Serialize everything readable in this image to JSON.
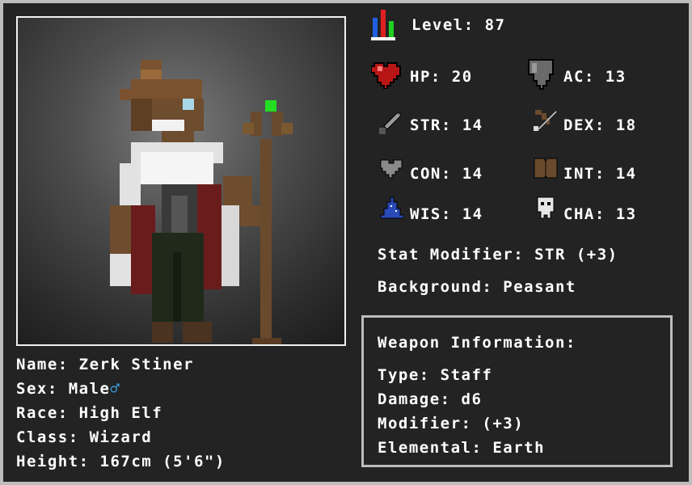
{
  "level": {
    "label": "Level:",
    "value": "87",
    "icon": "bar-chart-icon"
  },
  "stats": {
    "hp": {
      "label": "HP:",
      "value": "20",
      "icon": "heart-icon"
    },
    "ac": {
      "label": "AC:",
      "value": "13",
      "icon": "shield-icon"
    },
    "str": {
      "label": "STR:",
      "value": "14",
      "icon": "sword-icon"
    },
    "dex": {
      "label": "DEX:",
      "value": "18",
      "icon": "bow-icon"
    },
    "con": {
      "label": "CON:",
      "value": "14",
      "icon": "grey-heart-icon"
    },
    "int": {
      "label": "INT:",
      "value": "14",
      "icon": "book-icon"
    },
    "wis": {
      "label": "WIS:",
      "value": "14",
      "icon": "wizard-hat-icon"
    },
    "cha": {
      "label": "CHA:",
      "value": "13",
      "icon": "mask-icon"
    }
  },
  "stat_modifier": {
    "label": "Stat Modifier:",
    "value": "STR (+3)"
  },
  "background": {
    "label": "Background:",
    "value": "Peasant"
  },
  "character": {
    "name": {
      "label": "Name:",
      "value": "Zerk Stiner"
    },
    "sex": {
      "label": "Sex:",
      "value": "Male",
      "symbol": "♂"
    },
    "race": {
      "label": "Race:",
      "value": "High Elf"
    },
    "class": {
      "label": "Class:",
      "value": "Wizard"
    },
    "height": {
      "label": "Height:",
      "value": "167cm (5'6\")"
    }
  },
  "weapon": {
    "title": "Weapon Information:",
    "type": {
      "label": "Type:",
      "value": "Staff"
    },
    "damage": {
      "label": "Damage:",
      "value": "d6"
    },
    "modifier": {
      "label": "Modifier:",
      "value": "(+3)"
    },
    "elemental": {
      "label": "Elemental:",
      "value": "Earth"
    }
  },
  "colors": {
    "background": "#232323",
    "border": "#bdbdbd",
    "text": "#ffffff",
    "male_symbol": "#3aa0e0",
    "staff_gem": "#22dd22"
  }
}
